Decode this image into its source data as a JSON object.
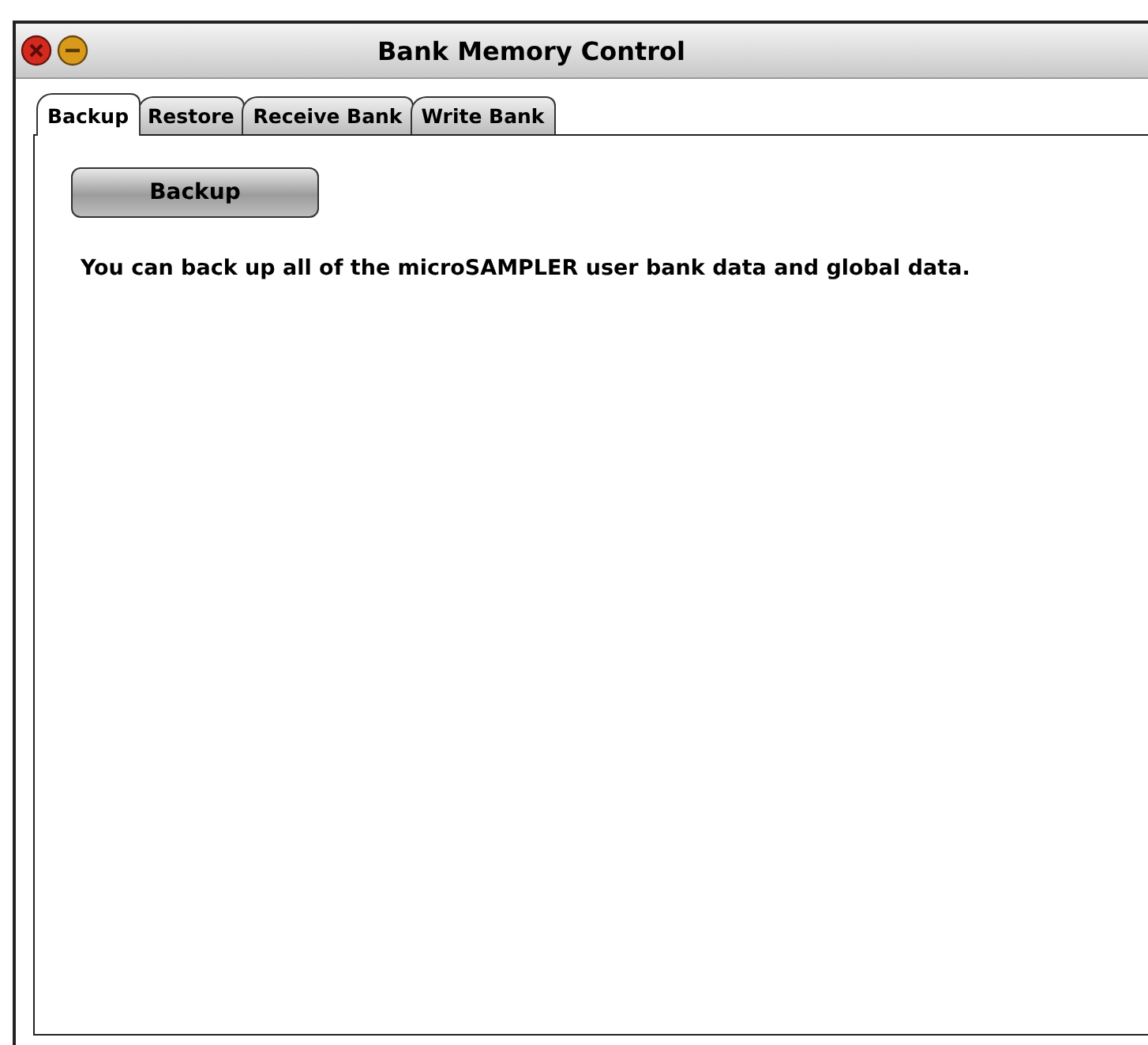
{
  "window": {
    "title": "Bank Memory Control"
  },
  "tabs": [
    {
      "label": "Backup",
      "selected": true
    },
    {
      "label": "Restore",
      "selected": false
    },
    {
      "label": "Receive Bank",
      "selected": false
    },
    {
      "label": "Write Bank",
      "selected": false
    }
  ],
  "content": {
    "button": "Backup",
    "description": "You can back up all of the microSAMPLER user bank data and global data."
  }
}
